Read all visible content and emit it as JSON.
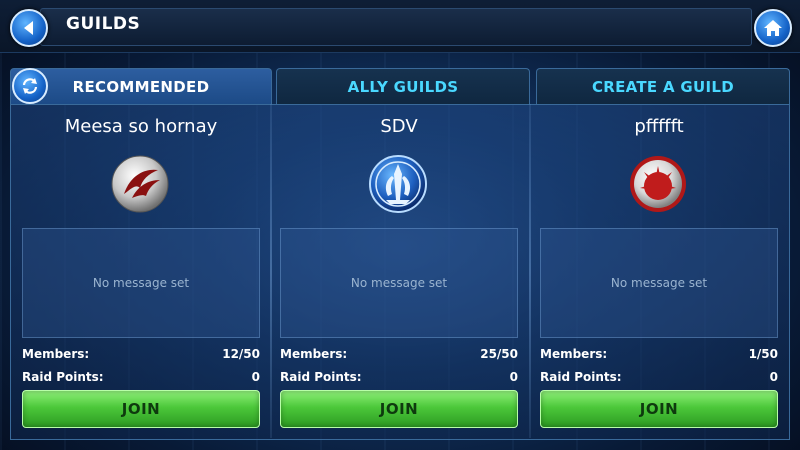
{
  "header": {
    "title": "GUILDS",
    "back_icon": "back-arrow-icon",
    "home_icon": "home-icon"
  },
  "tabs": [
    {
      "label": "RECOMMENDED",
      "active": true
    },
    {
      "label": "ALLY GUILDS",
      "active": false
    },
    {
      "label": "CREATE A GUILD",
      "active": false
    }
  ],
  "refresh_icon": "refresh-icon",
  "labels": {
    "members": "Members:",
    "raid_points": "Raid Points:",
    "join": "JOIN"
  },
  "guilds": [
    {
      "name": "Meesa so hornay",
      "emblem": "rebel-starbird-emblem-icon",
      "message": "No message set",
      "members": "12/50",
      "raid_points": "0"
    },
    {
      "name": "SDV",
      "emblem": "old-republic-emblem-icon",
      "message": "No message set",
      "members": "25/50",
      "raid_points": "0"
    },
    {
      "name": "pffffft",
      "emblem": "red-burst-emblem-icon",
      "message": "No message set",
      "members": "1/50",
      "raid_points": "0"
    }
  ],
  "colors": {
    "accent": "#4ad8ff",
    "join_green": "#4cc83a",
    "active_tab": "#2d5ea0"
  }
}
